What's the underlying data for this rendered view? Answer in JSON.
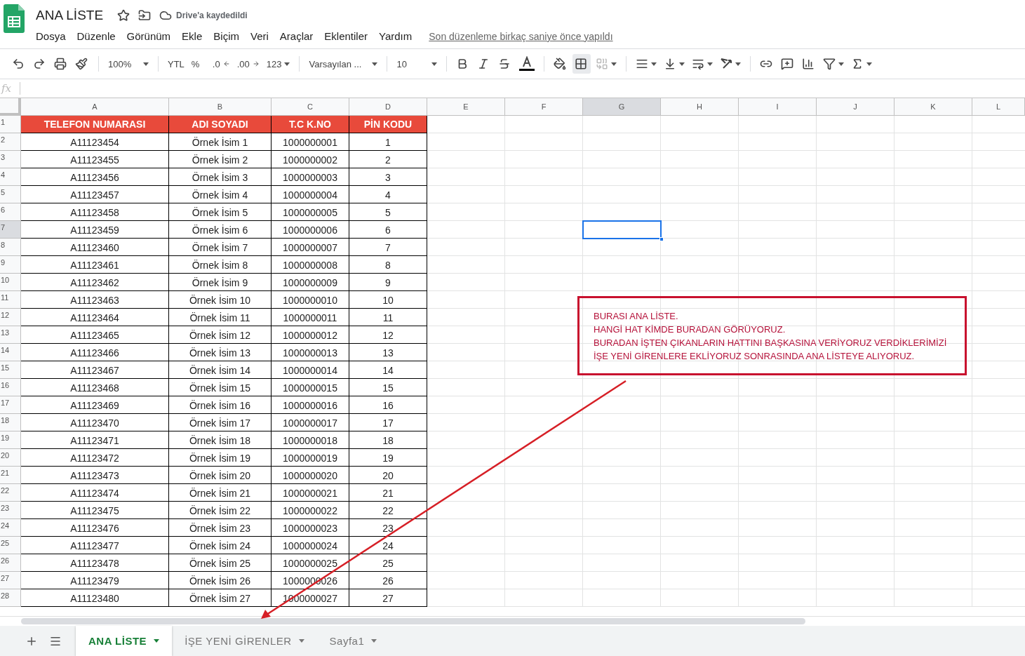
{
  "document": {
    "title": "ANA LİSTE",
    "save_status": "Drive'a kaydedildi"
  },
  "menu": [
    "Dosya",
    "Düzenle",
    "Görünüm",
    "Ekle",
    "Biçim",
    "Veri",
    "Araçlar",
    "Eklentiler",
    "Yardım"
  ],
  "last_edit": "Son düzenleme birkaç saniye önce yapıldı",
  "toolbar": {
    "zoom": "100%",
    "currency": "YTL",
    "percent": "%",
    "decrease_decimal": ".0",
    "increase_decimal": ".00",
    "number_format": "123",
    "font": "Varsayılan ...",
    "font_size": "10"
  },
  "formula_bar": {
    "label": "fx"
  },
  "columns": [
    {
      "label": "A",
      "selected": false
    },
    {
      "label": "B",
      "selected": false
    },
    {
      "label": "C",
      "selected": false
    },
    {
      "label": "D",
      "selected": false
    },
    {
      "label": "E",
      "selected": false
    },
    {
      "label": "F",
      "selected": false
    },
    {
      "label": "G",
      "selected": true
    },
    {
      "label": "H",
      "selected": false
    },
    {
      "label": "I",
      "selected": false
    },
    {
      "label": "J",
      "selected": false
    },
    {
      "label": "K",
      "selected": false
    },
    {
      "label": "L",
      "selected": false
    }
  ],
  "row_numbers": [
    {
      "label": "1",
      "selected": false
    },
    {
      "label": "2",
      "selected": false
    },
    {
      "label": "3",
      "selected": false
    },
    {
      "label": "4",
      "selected": false
    },
    {
      "label": "5",
      "selected": false
    },
    {
      "label": "6",
      "selected": false
    },
    {
      "label": "7",
      "selected": true
    },
    {
      "label": "8",
      "selected": false
    },
    {
      "label": "9",
      "selected": false
    },
    {
      "label": "10",
      "selected": false
    },
    {
      "label": "11",
      "selected": false
    },
    {
      "label": "12",
      "selected": false
    },
    {
      "label": "13",
      "selected": false
    },
    {
      "label": "14",
      "selected": false
    },
    {
      "label": "15",
      "selected": false
    },
    {
      "label": "16",
      "selected": false
    },
    {
      "label": "17",
      "selected": false
    },
    {
      "label": "18",
      "selected": false
    },
    {
      "label": "19",
      "selected": false
    },
    {
      "label": "20",
      "selected": false
    },
    {
      "label": "21",
      "selected": false
    },
    {
      "label": "22",
      "selected": false
    },
    {
      "label": "23",
      "selected": false
    },
    {
      "label": "24",
      "selected": false
    },
    {
      "label": "25",
      "selected": false
    },
    {
      "label": "26",
      "selected": false
    },
    {
      "label": "27",
      "selected": false
    },
    {
      "label": "28",
      "selected": false
    }
  ],
  "table": {
    "header": [
      "TELEFON NUMARASI",
      "ADI SOYADI",
      "T.C K.NO",
      "PİN KODU"
    ],
    "rows": [
      [
        "A11123454",
        "Örnek İsim 1",
        "1000000001",
        "1"
      ],
      [
        "A11123455",
        "Örnek İsim 2",
        "1000000002",
        "2"
      ],
      [
        "A11123456",
        "Örnek İsim 3",
        "1000000003",
        "3"
      ],
      [
        "A11123457",
        "Örnek İsim 4",
        "1000000004",
        "4"
      ],
      [
        "A11123458",
        "Örnek İsim 5",
        "1000000005",
        "5"
      ],
      [
        "A11123459",
        "Örnek İsim 6",
        "1000000006",
        "6"
      ],
      [
        "A11123460",
        "Örnek İsim 7",
        "1000000007",
        "7"
      ],
      [
        "A11123461",
        "Örnek İsim 8",
        "1000000008",
        "8"
      ],
      [
        "A11123462",
        "Örnek İsim 9",
        "1000000009",
        "9"
      ],
      [
        "A11123463",
        "Örnek İsim 10",
        "1000000010",
        "10"
      ],
      [
        "A11123464",
        "Örnek İsim 11",
        "1000000011",
        "11"
      ],
      [
        "A11123465",
        "Örnek İsim 12",
        "1000000012",
        "12"
      ],
      [
        "A11123466",
        "Örnek İsim 13",
        "1000000013",
        "13"
      ],
      [
        "A11123467",
        "Örnek İsim 14",
        "1000000014",
        "14"
      ],
      [
        "A11123468",
        "Örnek İsim 15",
        "1000000015",
        "15"
      ],
      [
        "A11123469",
        "Örnek İsim 16",
        "1000000016",
        "16"
      ],
      [
        "A11123470",
        "Örnek İsim 17",
        "1000000017",
        "17"
      ],
      [
        "A11123471",
        "Örnek İsim 18",
        "1000000018",
        "18"
      ],
      [
        "A11123472",
        "Örnek İsim 19",
        "1000000019",
        "19"
      ],
      [
        "A11123473",
        "Örnek İsim 20",
        "1000000020",
        "20"
      ],
      [
        "A11123474",
        "Örnek İsim 21",
        "1000000021",
        "21"
      ],
      [
        "A11123475",
        "Örnek İsim 22",
        "1000000022",
        "22"
      ],
      [
        "A11123476",
        "Örnek İsim 23",
        "1000000023",
        "23"
      ],
      [
        "A11123477",
        "Örnek İsim 24",
        "1000000024",
        "24"
      ],
      [
        "A11123478",
        "Örnek İsim 25",
        "1000000025",
        "25"
      ],
      [
        "A11123479",
        "Örnek İsim 26",
        "1000000026",
        "26"
      ],
      [
        "A11123480",
        "Örnek İsim 27",
        "1000000027",
        "27"
      ]
    ]
  },
  "note": {
    "lines": [
      "BURASI ANA LİSTE.",
      "HANGİ HAT KİMDE BURADAN GÖRÜYORUZ.",
      "BURADAN İŞTEN ÇIKANLARIN HATTINI BAŞKASINA VERİYORUZ VERDİKLERİMİZİ",
      "İŞE YENİ GİRENLERE EKLİYORUZ SONRASINDA ANA LİSTEYE ALIYORUZ."
    ]
  },
  "sheet_tabs": [
    {
      "label": "ANA LİSTE",
      "selected": true
    },
    {
      "label": "İŞE YENİ GİRENLER",
      "selected": false
    },
    {
      "label": "Sayfa1",
      "selected": false
    }
  ]
}
